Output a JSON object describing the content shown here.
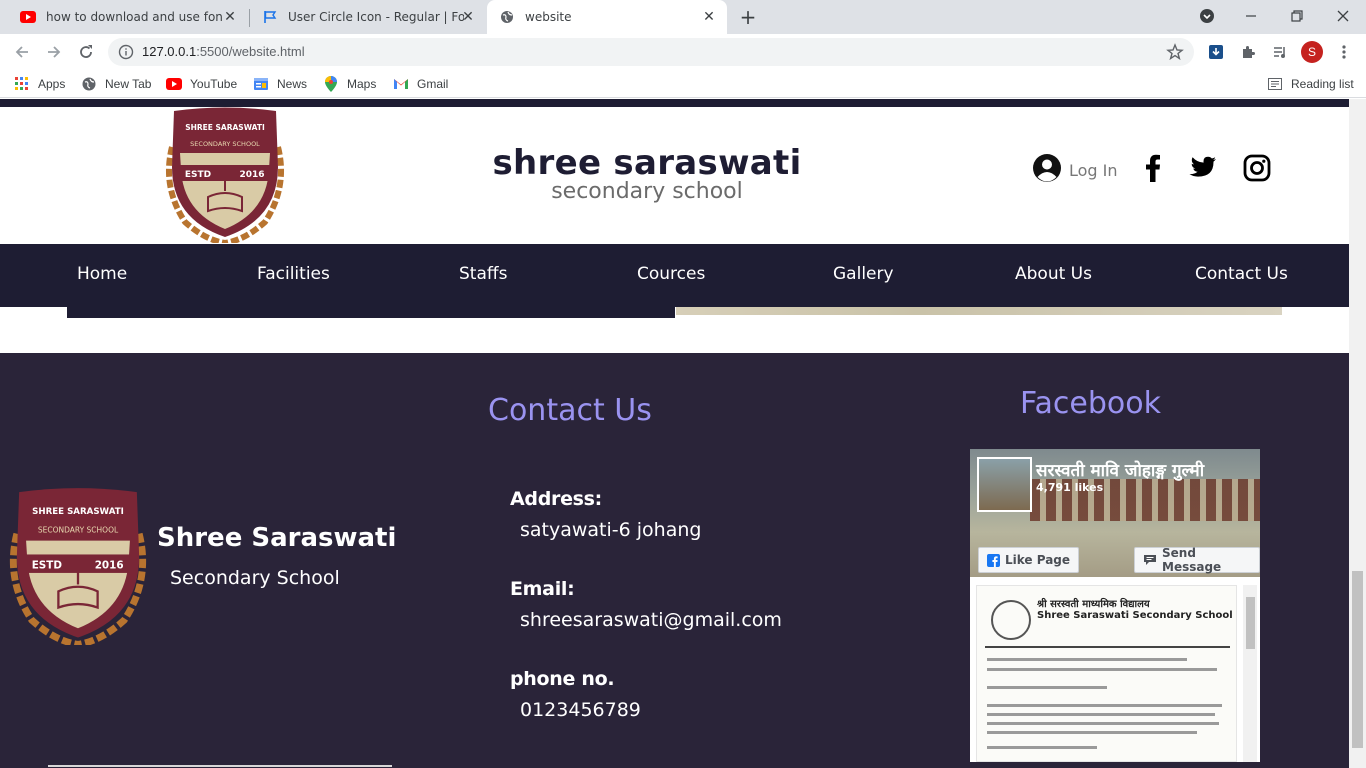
{
  "browser": {
    "tabs": [
      {
        "title": "how to download and use fontawesome",
        "icon": "youtube-icon"
      },
      {
        "title": "User Circle Icon - Regular | Font Awesome",
        "icon": "flag-icon"
      },
      {
        "title": "website",
        "icon": "globe-icon",
        "active": true
      }
    ],
    "address": {
      "host": "127.0.0.1",
      "rest": ":5500/website.html"
    },
    "profile_initial": "S",
    "bookmarks": [
      {
        "label": "Apps",
        "icon": "apps-grid-icon"
      },
      {
        "label": "New Tab",
        "icon": "globe-icon"
      },
      {
        "label": "YouTube",
        "icon": "youtube-icon"
      },
      {
        "label": "News",
        "icon": "news-icon"
      },
      {
        "label": "Maps",
        "icon": "maps-pin-icon"
      },
      {
        "label": "Gmail",
        "icon": "gmail-icon"
      }
    ],
    "reading_list": "Reading list"
  },
  "header": {
    "title": "shree saraswati",
    "subtitle": "secondary school",
    "login_label": "Log In",
    "logo_text": {
      "line1": "SHREE SARASWATI",
      "line2": "SECONDARY SCHOOL",
      "estd": "ESTD",
      "year": "2016"
    }
  },
  "nav": {
    "items": [
      "Home",
      "Facilities",
      "Staffs",
      "Cources",
      "Gallery",
      "About Us",
      "Contact Us"
    ]
  },
  "footer": {
    "school_name": "Shree Saraswati",
    "school_sub": "Secondary School",
    "contact_heading": "Contact Us",
    "address_label": "Address:",
    "address_value": "satyawati-6 johang",
    "email_label": "Email:",
    "email_value": "shreesaraswati@gmail.com",
    "phone_label": "phone no.",
    "phone_value": "0123456789",
    "facebook_heading": "Facebook",
    "fb": {
      "page_name": "सरस्वती मावि जोहाङ्ग गुल्मी",
      "likes": "4,791 likes",
      "like_button": "Like Page",
      "message_button": "Send Message",
      "post_line1": "श्री सरस्वती माध्यमिक विद्यालय",
      "post_line2": "Shree Saraswati Secondary School"
    }
  },
  "colors": {
    "navy": "#1e1d33",
    "footer_bg": "#2a2439",
    "accent_heading": "#9a93f0",
    "logo_maroon": "#7a2636",
    "logo_gold": "#b8742f"
  }
}
